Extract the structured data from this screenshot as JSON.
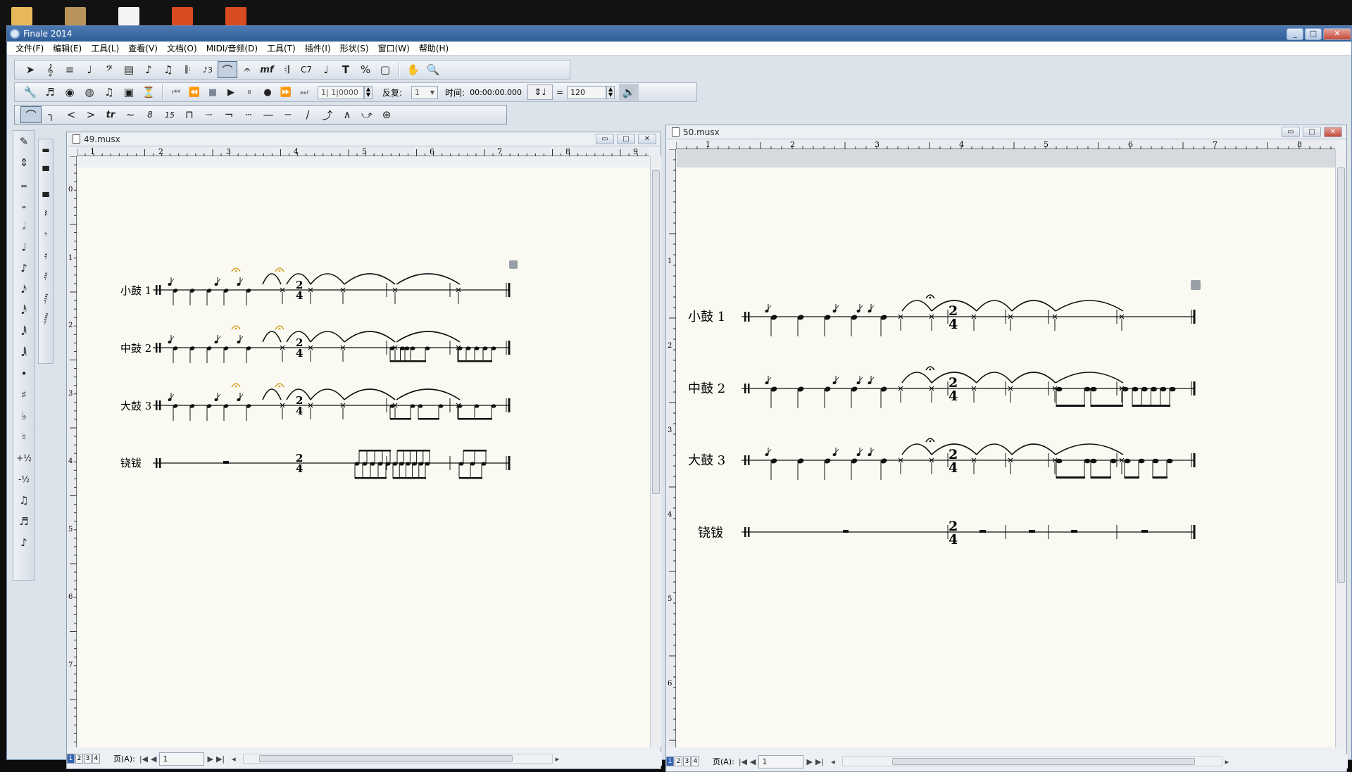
{
  "window": {
    "title": "Finale 2014"
  },
  "desktop_icons": [
    {
      "name": "folder-icon",
      "color": "#e7b85a"
    },
    {
      "name": "folder-video-icon",
      "color": "#b8945a"
    },
    {
      "name": "pdf-file-icon",
      "color": "#f4f4f4"
    },
    {
      "name": "powerpoint-file-icon",
      "color": "#d84a21"
    },
    {
      "name": "powerpoint-file-icon",
      "color": "#d84a21"
    }
  ],
  "menu": [
    "文件(F)",
    "编辑(E)",
    "工具(L)",
    "查看(V)",
    "文档(O)",
    "MIDI/音频(D)",
    "工具(T)",
    "插件(I)",
    "形状(S)",
    "窗口(W)",
    "帮助(H)"
  ],
  "playback": {
    "counter": "1| 1|0000",
    "repeat_label": "反复:",
    "repeat_value": "1",
    "time_label": "时间:",
    "time_value": "00:00:00.000",
    "equals": "=",
    "tempo": "120"
  },
  "doc_left": {
    "title": "49.musx",
    "ruler_numbers": [
      "1",
      "2",
      "3",
      "4",
      "5",
      "6",
      "7",
      "8",
      "9"
    ],
    "vruler_numbers": [
      "0",
      "1",
      "2",
      "3",
      "4",
      "5",
      "6",
      "7"
    ],
    "staff_labels": [
      "小鼓 1",
      "中鼓 2",
      "大鼓 3",
      "铙钹"
    ],
    "time_signature": {
      "num": "2",
      "den": "4"
    },
    "page_tabs": [
      "1",
      "2",
      "3",
      "4"
    ],
    "page_label": "页(A):",
    "page_value": "1"
  },
  "doc_right": {
    "title": "50.musx",
    "ruler_numbers": [
      "1",
      "2",
      "3",
      "4",
      "5",
      "6",
      "7",
      "8"
    ],
    "vruler_numbers": [
      "1",
      "2",
      "3",
      "4",
      "5",
      "6"
    ],
    "staff_labels": [
      "小鼓 1",
      "中鼓 2",
      "大鼓 3",
      "铙钹"
    ],
    "time_signature": {
      "num": "2",
      "den": "4"
    },
    "page_tabs": [
      "1",
      "2",
      "3",
      "4"
    ],
    "page_label": "页(A):",
    "page_value": "1"
  }
}
